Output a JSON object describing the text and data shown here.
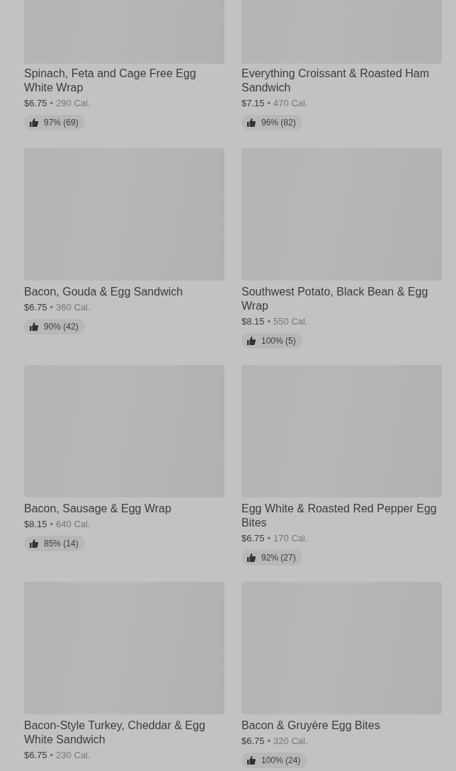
{
  "items": [
    {
      "name": "Spinach, Feta and Cage Free Egg White Wrap",
      "price": "$6.75",
      "separator": "•",
      "calories": "290 Cal.",
      "rating": "97% (69)"
    },
    {
      "name": "Everything Croissant & Roasted Ham Sandwich",
      "price": "$7.15",
      "separator": "•",
      "calories": "470 Cal.",
      "rating": "96% (82)"
    },
    {
      "name": "Bacon, Gouda & Egg Sandwich",
      "price": "$6.75",
      "separator": "•",
      "calories": "360 Cal.",
      "rating": "90% (42)"
    },
    {
      "name": "Southwest Potato, Black Bean & Egg Wrap",
      "price": "$8.15",
      "separator": "•",
      "calories": "550 Cal.",
      "rating": "100% (5)"
    },
    {
      "name": "Bacon, Sausage & Egg Wrap",
      "price": "$8.15",
      "separator": "•",
      "calories": "640 Cal.",
      "rating": "85% (14)"
    },
    {
      "name": "Egg White & Roasted Red Pepper Egg Bites",
      "price": "$6.75",
      "separator": "•",
      "calories": "170 Cal.",
      "rating": "92% (27)"
    },
    {
      "name": "Bacon-Style Turkey, Cheddar & Egg White Sandwich",
      "price": "$6.75",
      "separator": "•",
      "calories": "230 Cal."
    },
    {
      "name": "Bacon & Gruyère Egg Bites",
      "price": "$6.75",
      "separator": "•",
      "calories": "320 Cal.",
      "rating": "100% (24)"
    }
  ]
}
